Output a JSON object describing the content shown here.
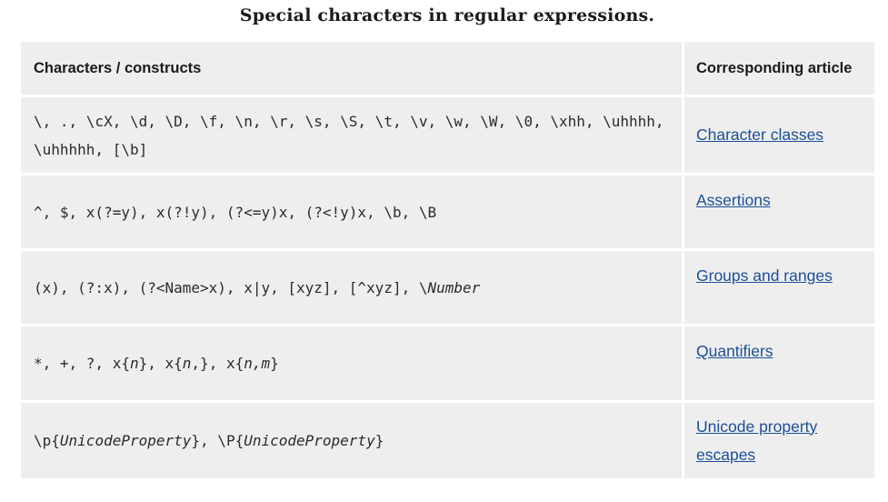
{
  "caption": "Special characters in regular expressions.",
  "headers": {
    "col1": "Characters / constructs",
    "col2": "Corresponding article"
  },
  "rows": [
    {
      "line1": "\\, ., \\cX, \\d, \\D, \\f, \\n, \\r, \\s, \\S, \\t, \\v, \\w, \\W, \\0, \\xhh, \\uhhhh,",
      "line2": "\\uhhhhh, [\\b]",
      "article": "Character classes"
    },
    {
      "line1": "^, $, x(?=y), x(?!y), (?<=y)x, (?<!y)x, \\b, \\B",
      "article": "Assertions"
    },
    {
      "line1": "(x), (?:x), (?<Name>x), x|y, [xyz], [^xyz], \\",
      "italic": "Number",
      "article": "Groups and ranges"
    },
    {
      "parts": [
        "*, +, ?, x{",
        "n",
        "}, x{",
        "n",
        ",}, x{",
        "n,m",
        "}"
      ],
      "article": "Quantifiers"
    },
    {
      "parts": [
        "\\p{",
        "UnicodeProperty",
        "}, \\P{",
        "UnicodeProperty",
        "}"
      ],
      "article_line1": "Unicode property",
      "article_line2": "escapes"
    }
  ]
}
